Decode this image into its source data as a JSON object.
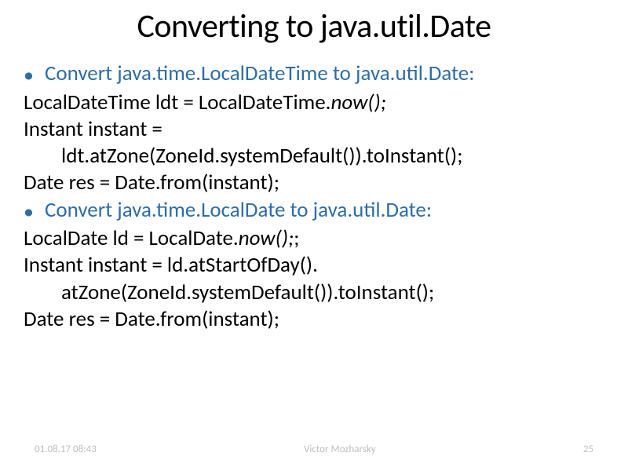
{
  "slide": {
    "title": "Converting to java.util.Date",
    "bullets": [
      {
        "heading": "Convert java.time.LocalDateTime to java.util.Date:",
        "lines": [
          {
            "pre": "LocalDateTime ldt = LocalDateTime.",
            "it": "now();",
            "post": ""
          },
          {
            "pre": "Instant instant =",
            "it": "",
            "post": ""
          },
          {
            "pre": "ldt.atZone(ZoneId.systemDefault()).toInstant();",
            "it": "",
            "post": "",
            "indent": true
          },
          {
            "pre": "Date res = Date.from(instant);",
            "it": "",
            "post": ""
          }
        ]
      },
      {
        "heading": "Convert java.time.LocalDate to java.util.Date:",
        "lines": [
          {
            "pre": "LocalDate ld = LocalDate.",
            "it": "now();",
            "post": ";"
          },
          {
            "pre": "Instant instant = ld.atStartOfDay().",
            "it": "",
            "post": ""
          },
          {
            "pre": "atZone(ZoneId.systemDefault()).toInstant();",
            "it": "",
            "post": "",
            "indent": true
          },
          {
            "pre": "Date res = Date.from(instant);",
            "it": "",
            "post": ""
          }
        ]
      }
    ]
  },
  "footer": {
    "date": "01.08.17 08:43",
    "author": "Victor Mozharsky",
    "page": "25"
  }
}
